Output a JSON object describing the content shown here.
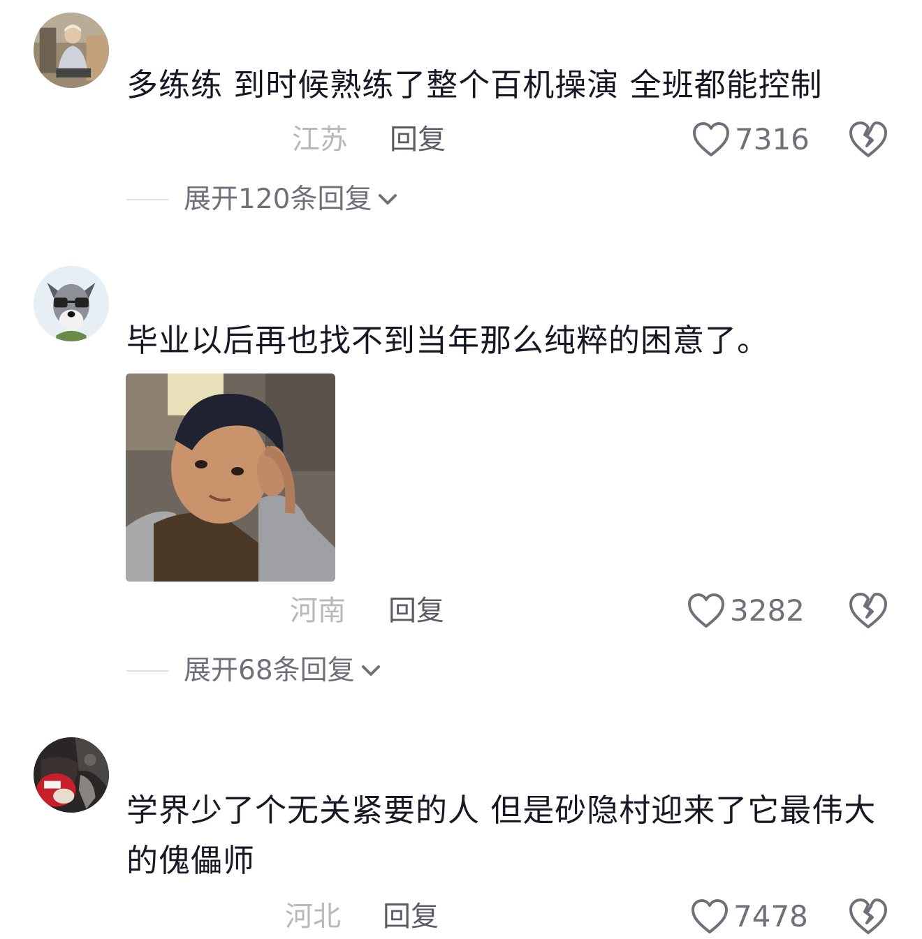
{
  "comments": [
    {
      "avatar_icon": "avatar-person-photo",
      "text": "多练练 到时候熟练了整个百机操演 全班都能控制",
      "location": "江苏",
      "reply_label": "回复",
      "like_count": "7316",
      "expand_label": "展开120条回复"
    },
    {
      "avatar_icon": "avatar-dog-with-glasses",
      "text": "毕业以后再也找不到当年那么纯粹的困意了。",
      "sticker_icon": "sleepy-man-meme-sticker",
      "location": "河南",
      "reply_label": "回复",
      "like_count": "3282",
      "expand_label": "展开68条回复"
    },
    {
      "avatar_icon": "avatar-dark-anime",
      "text": "学界少了个无关紧要的人 但是砂隐村迎来了它最伟大的傀儡师",
      "location": "河北",
      "reply_label": "回复",
      "like_count": "7478"
    }
  ],
  "icons": {
    "like": "heart-outline-icon",
    "dislike": "broken-heart-icon",
    "expand": "chevron-down-icon"
  },
  "colors": {
    "text": "#161823",
    "muted": "#b7b8bd",
    "secondary": "#6f7079"
  }
}
